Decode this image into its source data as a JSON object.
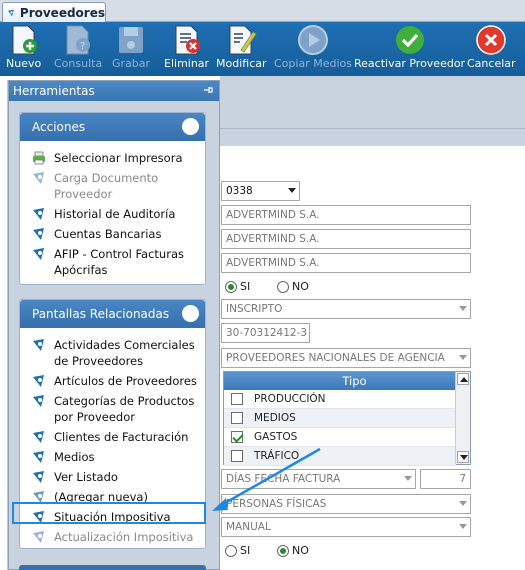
{
  "tab": {
    "title": "Proveedores"
  },
  "toolbar": {
    "buttons": [
      {
        "label": "Nuevo"
      },
      {
        "label": "Consulta"
      },
      {
        "label": "Grabar"
      },
      {
        "label": "Eliminar"
      },
      {
        "label": "Modificar"
      },
      {
        "label": "Copiar Medios"
      },
      {
        "label": "Reactivar Proveedor"
      },
      {
        "label": "Cancelar"
      }
    ]
  },
  "panel": {
    "title": "Herramientas",
    "acciones": {
      "title": "Acciones",
      "items": [
        {
          "label": "Seleccionar Impresora"
        },
        {
          "label": "Carga Documento Proveedor"
        },
        {
          "label": "Historial de Auditoría"
        },
        {
          "label": "Cuentas Bancarias"
        },
        {
          "label": "AFIP - Control Facturas Apócrifas"
        }
      ]
    },
    "pantallas": {
      "title": "Pantallas Relacionadas",
      "items": [
        {
          "label": "Actividades Comerciales de Proveedores"
        },
        {
          "label": "Artículos de Proveedores"
        },
        {
          "label": "Categorías de Productos por Proveedor"
        },
        {
          "label": "Clientes de Facturación"
        },
        {
          "label": "Medios"
        },
        {
          "label": "Ver Listado"
        },
        {
          "label": "(Agregar nueva)"
        },
        {
          "label": "Situación Impositiva"
        },
        {
          "label": "Actualización Impositiva"
        }
      ]
    }
  },
  "form": {
    "code": "0338",
    "name1": "ADVERTMIND S.A.",
    "name2": "ADVERTMIND S.A.",
    "name3": "ADVERTMIND S.A.",
    "radio1": {
      "si": "SI",
      "no": "NO",
      "selected": "SI"
    },
    "iva": "INSCRIPTO",
    "cuit": "30-70312412-3",
    "clase": "PROVEEDORES NACIONALES DE AGENCIA",
    "grid": {
      "header": "Tipo",
      "rows": [
        {
          "label": "PRODUCCIÓN",
          "checked": false
        },
        {
          "label": "MEDIOS",
          "checked": false
        },
        {
          "label": "GASTOS",
          "checked": true
        },
        {
          "label": "TRÁFICO",
          "checked": false
        }
      ]
    },
    "plazo": "DÍAS FECHA FACTURA",
    "plazo_dias": "7",
    "persona": "PERSONAS FÍSICAS",
    "modo": "MANUAL",
    "radio2": {
      "si": "SI",
      "no": "NO",
      "selected": "NO"
    }
  },
  "colors": {
    "toolbar": "#1a66a8",
    "accent_highlight": "#1e88e5"
  }
}
